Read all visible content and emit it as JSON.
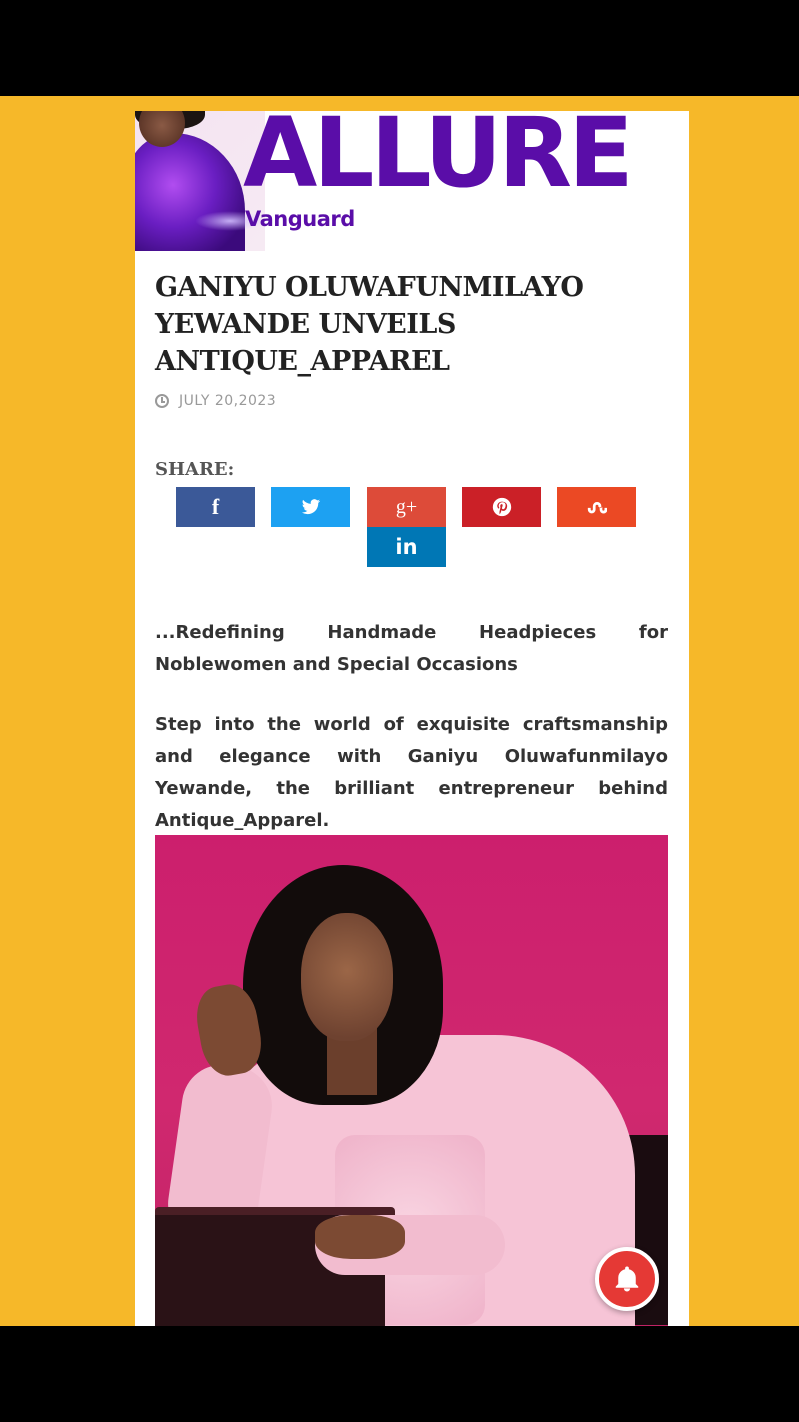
{
  "masthead": {
    "logo_word": "ALLURE",
    "logo_sub": "Vanguard"
  },
  "article": {
    "title": "GANIYU OLUWAFUNMILAYO YEWANDE UNVEILS ANTIQUE_APPAREL",
    "date": "JULY 20,2023",
    "share_label": "SHARE:",
    "intro": "...Redefining Handmade Headpieces for Noblewomen and Special Occasions",
    "paragraph": "Step into the world of exquisite craftsmanship and elegance with Ganiyu Oluwafunmilayo Yewande, the brilliant entrepreneur behind Antique_Apparel."
  },
  "share_buttons": [
    {
      "name": "facebook",
      "icon": "facebook-icon",
      "color": "#3B5998"
    },
    {
      "name": "twitter",
      "icon": "twitter-icon",
      "color": "#1DA1F2"
    },
    {
      "name": "google-plus",
      "icon": "google-plus-icon",
      "color": "#DD4B39"
    },
    {
      "name": "pinterest",
      "icon": "pinterest-icon",
      "color": "#CB2027"
    },
    {
      "name": "stumbleupon",
      "icon": "stumbleupon-icon",
      "color": "#EB4924"
    },
    {
      "name": "linkedin",
      "icon": "linkedin-icon",
      "color": "#0077B5"
    }
  ],
  "share_glyphs": {
    "facebook": "f",
    "google_plus": "g+",
    "linkedin": "in"
  },
  "colors": {
    "background": "#F6B829",
    "brand": "#5A0DA8",
    "notification": "#E53935"
  },
  "notification": {
    "icon": "bell-icon"
  }
}
